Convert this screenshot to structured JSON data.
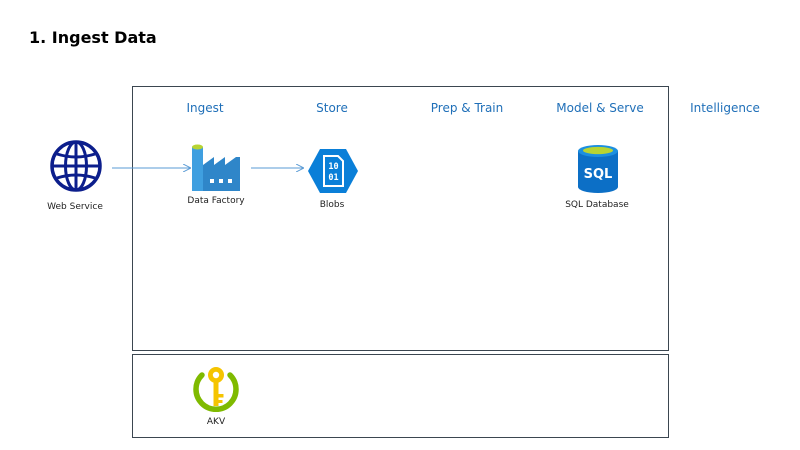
{
  "title": "1. Ingest Data",
  "stages": {
    "ingest": "Ingest",
    "store": "Store",
    "prep_train": "Prep & Train",
    "model_serve": "Model & Serve",
    "intelligence": "Intelligence"
  },
  "nodes": {
    "web_service": {
      "label": "Web Service",
      "icon": "globe-icon"
    },
    "data_factory": {
      "label": "Data Factory",
      "icon": "factory-icon"
    },
    "blobs": {
      "label": "Blobs",
      "icon": "blob-storage-icon",
      "glyph_top": "10",
      "glyph_bottom": "01"
    },
    "sql_database": {
      "label": "SQL Database",
      "icon": "sql-database-icon",
      "glyph": "SQL"
    },
    "akv": {
      "label": "AKV",
      "icon": "key-vault-icon"
    }
  },
  "colors": {
    "stage_text": "#1f6fb8",
    "arrow": "#5a9bd5",
    "globe": "#0c1e8c",
    "azure_blue": "#0078d4",
    "key_yellow": "#f5c400",
    "key_ring_green": "#7fba00"
  }
}
